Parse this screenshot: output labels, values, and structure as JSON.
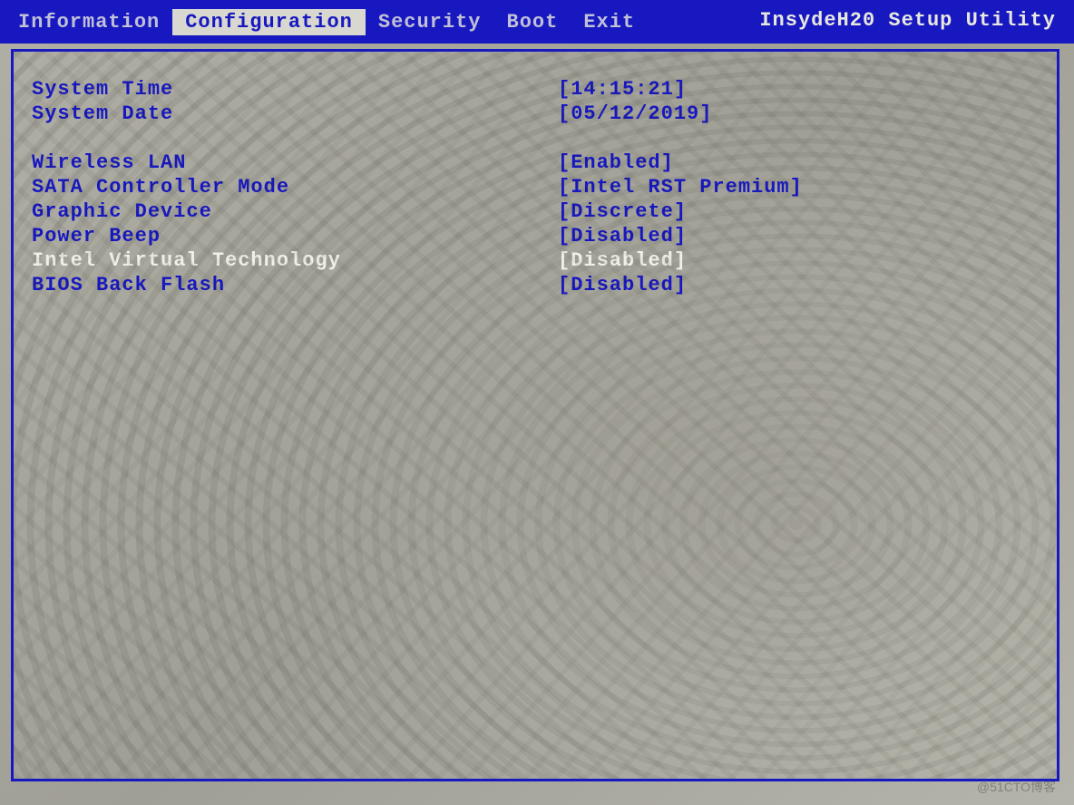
{
  "utility_title": "InsydeH20 Setup Utility",
  "tabs": {
    "information": "Information",
    "configuration": "Configuration",
    "security": "Security",
    "boot": "Boot",
    "exit": "Exit"
  },
  "settings": {
    "system_time": {
      "label": "System Time",
      "value": "[14:15:21]"
    },
    "system_date": {
      "label": "System Date",
      "value": "[05/12/2019]"
    },
    "wireless_lan": {
      "label": "Wireless LAN",
      "value": "[Enabled]"
    },
    "sata_mode": {
      "label": "SATA Controller Mode",
      "value": "[Intel RST Premium]"
    },
    "graphic_device": {
      "label": "Graphic Device",
      "value": "[Discrete]"
    },
    "power_beep": {
      "label": "Power Beep",
      "value": "[Disabled]"
    },
    "intel_vt": {
      "label": "Intel Virtual Technology",
      "value": "[Disabled]"
    },
    "bios_back_flash": {
      "label": "BIOS Back Flash",
      "value": "[Disabled]"
    }
  },
  "watermark": "@51CTO博客"
}
